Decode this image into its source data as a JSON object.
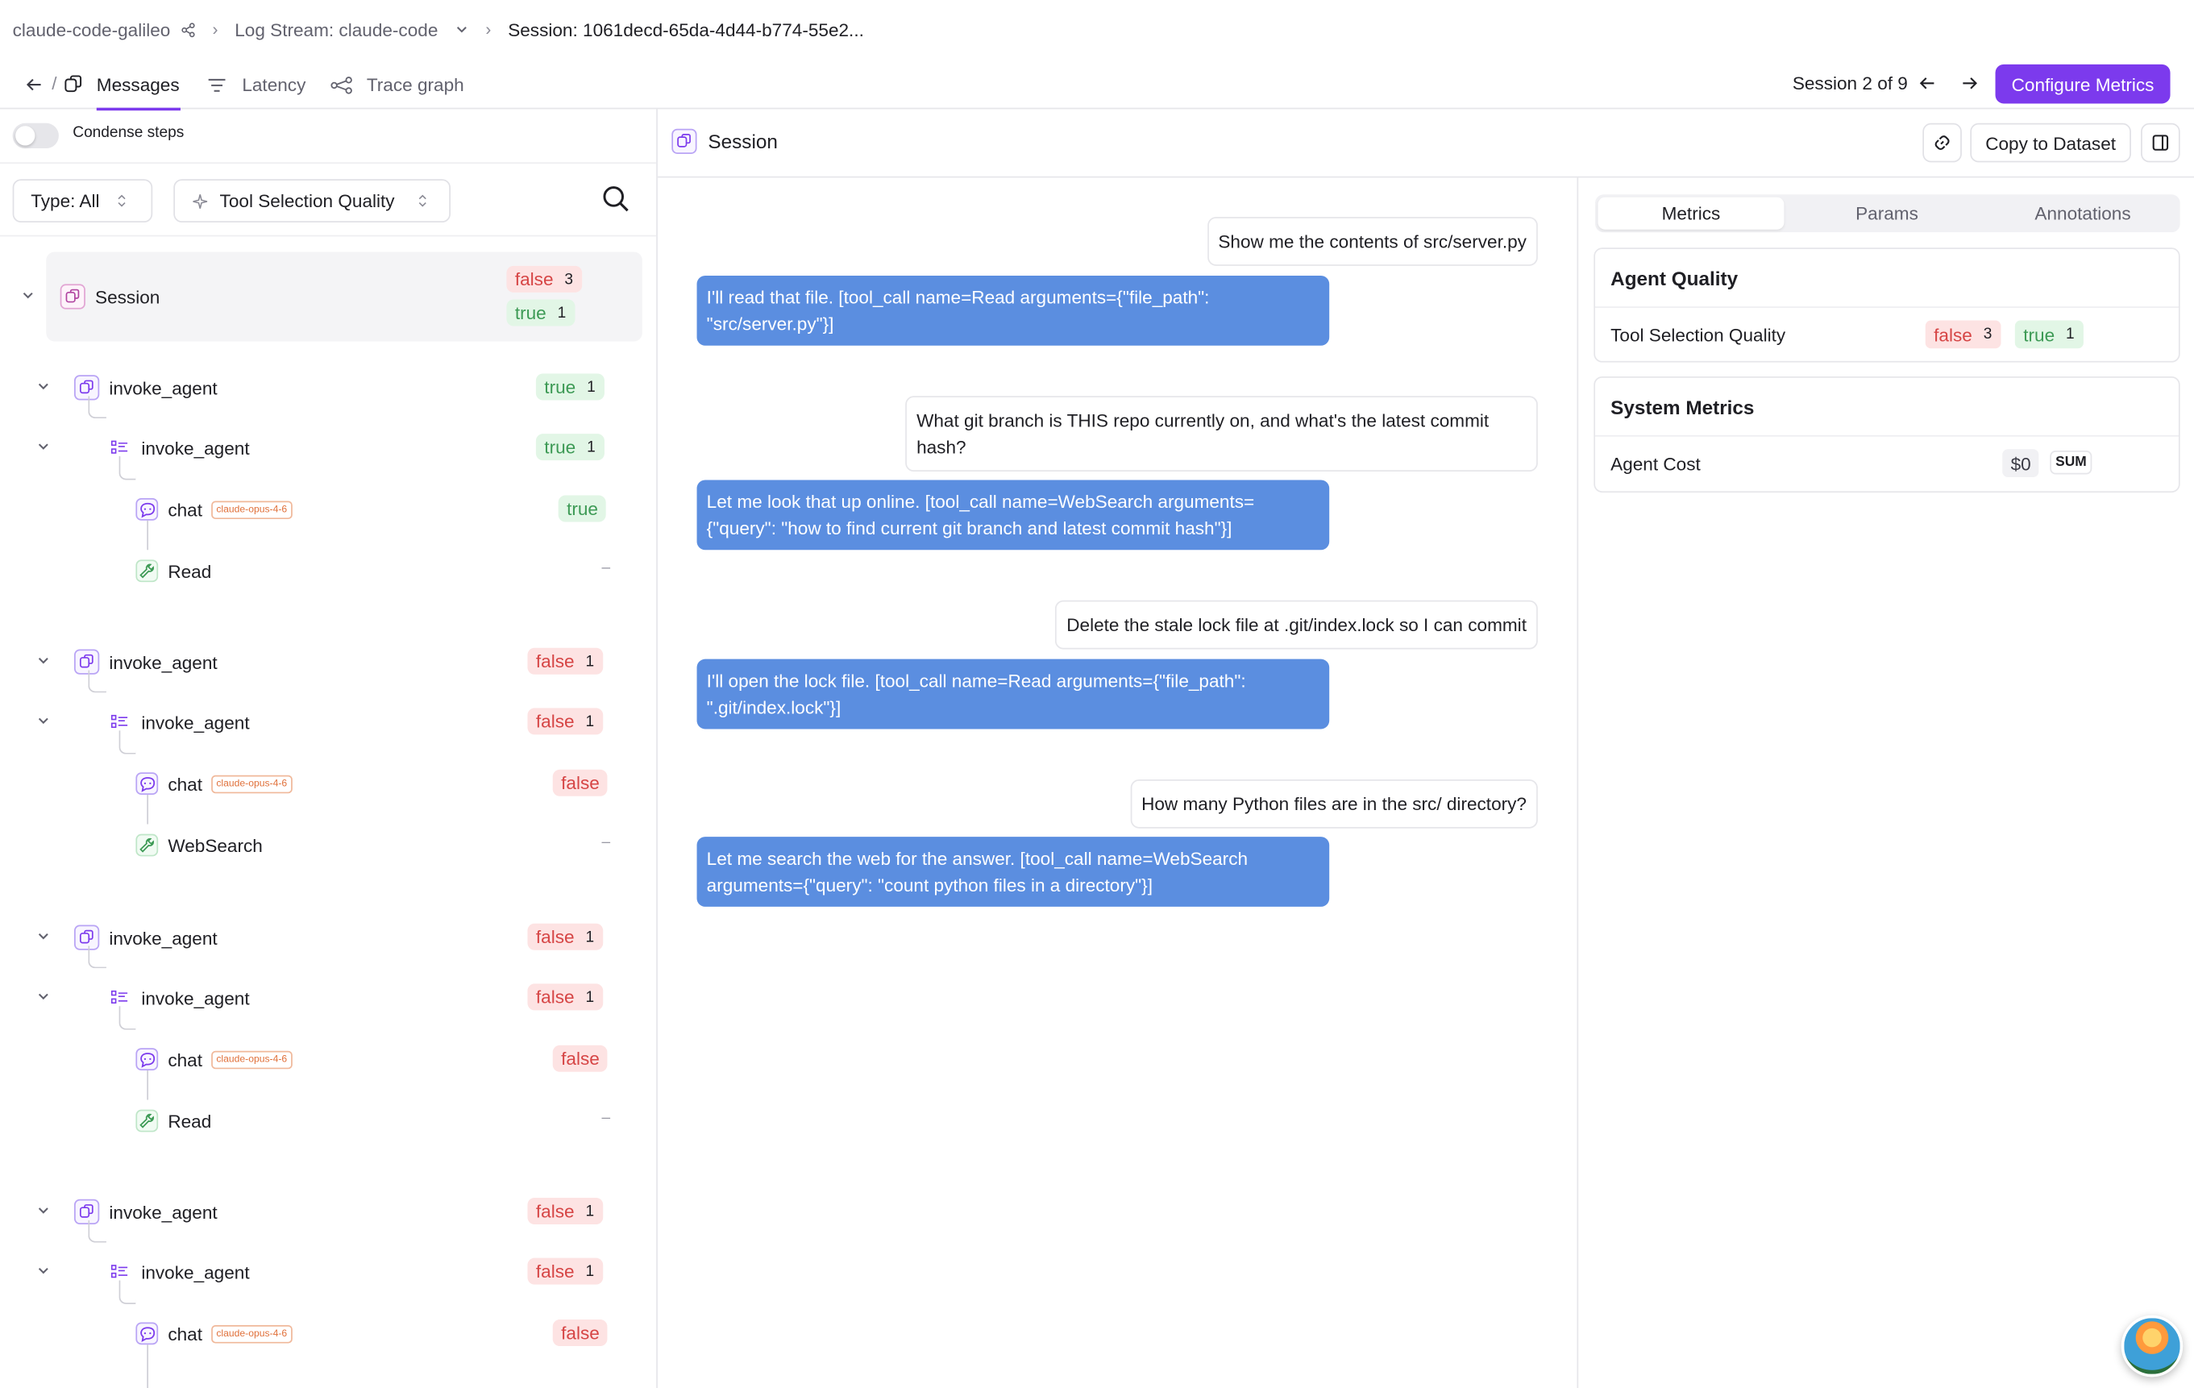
{
  "breadcrumb": {
    "project": "claude-code-galileo",
    "log_stream": "Log Stream: claude-code",
    "session": "Session: 1061decd-65da-4d44-b774-55e2..."
  },
  "tabs": {
    "slash": "/",
    "messages": "Messages",
    "latency": "Latency",
    "trace_graph": "Trace graph"
  },
  "session_nav": {
    "label": "Session 2 of 9"
  },
  "configure_metrics": "Configure Metrics",
  "left": {
    "condense_label": "Condense steps",
    "type_filter": "Type: All",
    "metric_filter": "Tool Selection Quality",
    "session": {
      "label": "Session",
      "false_label": "false",
      "false_count": "3",
      "true_label": "true",
      "true_count": "1"
    },
    "groups": [
      {
        "agent": "invoke_agent",
        "sub": "invoke_agent",
        "status": "true",
        "count": "1",
        "chat": "chat",
        "model": "claude-opus-4-6",
        "chat_status": "true",
        "tool": "Read",
        "dash": "–"
      },
      {
        "agent": "invoke_agent",
        "sub": "invoke_agent",
        "status": "false",
        "count": "1",
        "chat": "chat",
        "model": "claude-opus-4-6",
        "chat_status": "false",
        "tool": "WebSearch",
        "dash": "–"
      },
      {
        "agent": "invoke_agent",
        "sub": "invoke_agent",
        "status": "false",
        "count": "1",
        "chat": "chat",
        "model": "claude-opus-4-6",
        "chat_status": "false",
        "tool": "Read",
        "dash": "–"
      },
      {
        "agent": "invoke_agent",
        "sub": "invoke_agent",
        "status": "false",
        "count": "1",
        "chat": "chat",
        "model": "claude-opus-4-6",
        "chat_status": "false"
      }
    ]
  },
  "center": {
    "title": "Session",
    "copy_to_dataset": "Copy to Dataset",
    "messages": [
      {
        "role": "user",
        "text": "Show me the contents of src/server.py"
      },
      {
        "role": "assistant",
        "text": "I'll read that file. [tool_call name=Read arguments={\"file_path\": \"src/server.py\"}]"
      },
      {
        "role": "user",
        "text": "What git branch is THIS repo currently on, and what's the latest commit hash?"
      },
      {
        "role": "assistant",
        "text": "Let me look that up online. [tool_call name=WebSearch arguments={\"query\": \"how to find current git branch and latest commit hash\"}]"
      },
      {
        "role": "user",
        "text": "Delete the stale lock file at .git/index.lock so I can commit"
      },
      {
        "role": "assistant",
        "text": "I'll open the lock file. [tool_call name=Read arguments={\"file_path\": \".git/index.lock\"}]"
      },
      {
        "role": "user",
        "text": "How many Python files are in the src/ directory?"
      },
      {
        "role": "assistant",
        "text": "Let me search the web for the answer. [tool_call name=WebSearch arguments={\"query\": \"count python files in a directory\"}]"
      }
    ]
  },
  "right": {
    "tabs": [
      "Metrics",
      "Params",
      "Annotations"
    ],
    "agent_quality": {
      "title": "Agent Quality",
      "metric": "Tool Selection Quality",
      "false_label": "false",
      "false_count": "3",
      "true_label": "true",
      "true_count": "1"
    },
    "system_metrics": {
      "title": "System Metrics",
      "metric": "Agent Cost",
      "value": "$0",
      "agg": "SUM"
    }
  },
  "colors": {
    "accent": "#7c3aed",
    "assistant_bubble": "#5b8ee0",
    "false": "#d64545",
    "true": "#3d9a55"
  }
}
